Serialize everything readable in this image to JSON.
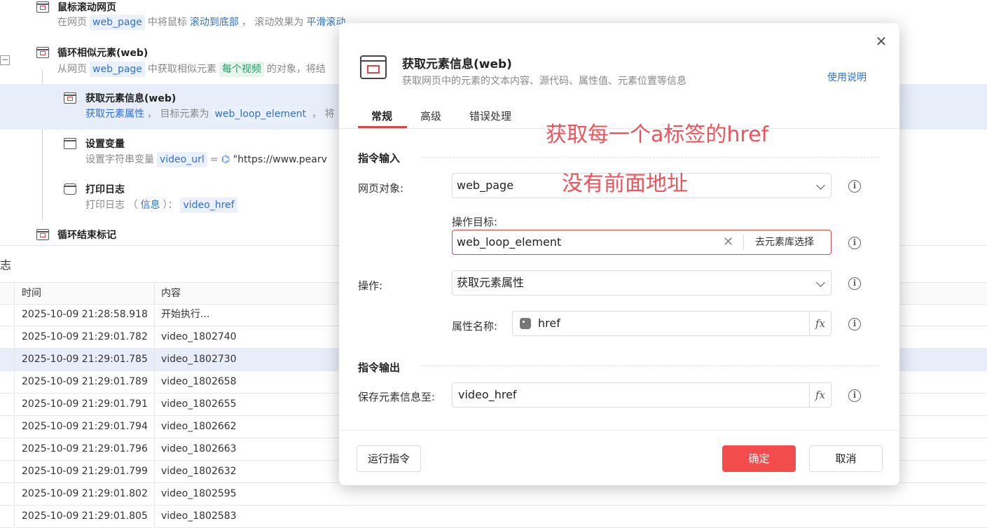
{
  "flow": {
    "items": [
      {
        "title": "鼠标滚动网页",
        "desc_a": "在网页",
        "tag1": "web_page",
        "desc_b": "中将鼠标",
        "link1": "滚动到底部",
        "desc_c": "，  滚动效果为",
        "link2": "平滑滚动"
      },
      {
        "title": "循环相似元素(web)",
        "desc_a": "从网页",
        "tag1": "web_page",
        "desc_b": "中获取相似元素",
        "tag2": "每个视频",
        "desc_c": "的对象，将结"
      },
      {
        "title": "获取元素信息(web)",
        "link1": "获取元素属性",
        "desc_a": "，  目标元素为",
        "tag1": "web_loop_element",
        "desc_b": "，  将"
      },
      {
        "title": "设置变量",
        "desc_a": "设置字符串变量",
        "tag1": "video_url",
        "desc_b": "=",
        "expr": "\"https://www.pearv"
      },
      {
        "title": "打印日志",
        "desc_a": "打印日志  （",
        "link1": "信息",
        "desc_b": "）：",
        "tag1": "video_href"
      },
      {
        "title": "循环结束标记"
      }
    ],
    "collapse_symbol": "−"
  },
  "log": {
    "title": "志",
    "columns": [
      "时间",
      "内容"
    ],
    "rows": [
      {
        "time": "2025-10-09 21:28:58.918",
        "content": "开始执行..."
      },
      {
        "time": "2025-10-09 21:29:01.782",
        "content": "video_1802740"
      },
      {
        "time": "2025-10-09 21:29:01.785",
        "content": "video_1802730"
      },
      {
        "time": "2025-10-09 21:29:01.789",
        "content": "video_1802658"
      },
      {
        "time": "2025-10-09 21:29:01.791",
        "content": "video_1802655"
      },
      {
        "time": "2025-10-09 21:29:01.794",
        "content": "video_1802662"
      },
      {
        "time": "2025-10-09 21:29:01.796",
        "content": "video_1802663"
      },
      {
        "time": "2025-10-09 21:29:01.799",
        "content": "video_1802632"
      },
      {
        "time": "2025-10-09 21:29:01.802",
        "content": "video_1802595"
      },
      {
        "time": "2025-10-09 21:29:01.805",
        "content": "video_1802583"
      }
    ]
  },
  "dialog": {
    "title": "获取元素信息(web)",
    "subtitle": "获取网页中的元素的文本内容、源代码、属性值、元素位置等信息",
    "help": "使用说明",
    "close": "✕",
    "tabs": [
      "常规",
      "高级",
      "错误处理"
    ],
    "section_input": "指令输入",
    "section_output": "指令输出",
    "web_obj_label": "网页对象:",
    "web_obj_value": "web_page",
    "target_label": "操作目标:",
    "target_value": "web_loop_element",
    "target_clear": "✕",
    "target_pick": "去元素库选择",
    "op_label": "操作:",
    "op_value": "获取元素属性",
    "attr_label": "属性名称:",
    "attr_value": "href",
    "save_label": "保存元素信息至:",
    "save_value": "video_href",
    "fx": "fx",
    "info": "i",
    "run_btn": "运行指令",
    "ok_btn": "确定",
    "cancel_btn": "取消"
  },
  "annotations": {
    "line1": "获取每一个a标签的href",
    "line2": "没有前面地址",
    "color": "#f0525a"
  },
  "colors": {
    "accent": "#e04545",
    "primary_btn": "#f24c4c",
    "link": "#2e6fd8",
    "selected_row": "#e8eef9"
  }
}
